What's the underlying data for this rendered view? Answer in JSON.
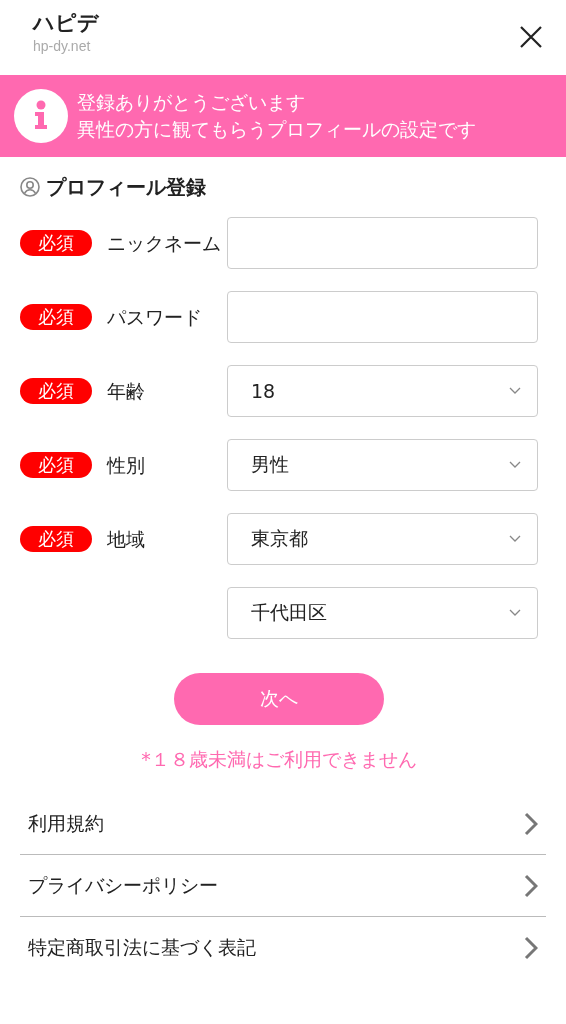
{
  "header": {
    "title": "ハピデ",
    "subtitle": "hp-dy.net"
  },
  "banner": {
    "lines": [
      "登録ありがとうございます",
      "異性の方に観てもらうプロフィールの設定です"
    ]
  },
  "section_title": "プロフィール登録",
  "fields": [
    {
      "kind": "text",
      "badge": "必須",
      "label": "ニックネーム"
    },
    {
      "kind": "password",
      "badge": "必須",
      "label": "パスワード"
    },
    {
      "kind": "select",
      "badge": "必須",
      "label": "年齢",
      "value": "18"
    },
    {
      "kind": "select",
      "badge": "必須",
      "label": "性別",
      "value": "男性"
    },
    {
      "kind": "select",
      "badge": "必須",
      "label": "地域",
      "value": "東京都"
    },
    {
      "kind": "select",
      "value": "千代田区"
    }
  ],
  "next_button": "次へ",
  "note": "*１８歳未満はご利用できません",
  "links": [
    "利用規約",
    "プライバシーポリシー",
    "特定商取引法に基づく表記"
  ]
}
